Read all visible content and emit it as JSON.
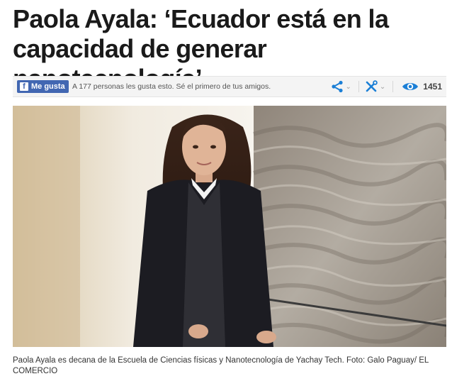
{
  "article": {
    "headline_line1": "Paola Ayala: ‘Ecuador está en la",
    "headline_line2": "capacidad de generar nanotecnología’"
  },
  "social": {
    "like_button_label": "Me gusta",
    "fb_icon_glyph": "f",
    "likes_text": "A 177 personas les gusta esto. Sé el primero de tus amigos.",
    "share_icon": "share-icon",
    "tools_icon": "wrench-screwdriver-icon",
    "views_icon": "eye-icon",
    "views_count": "1451",
    "accent_color": "#1b7fd6",
    "fb_color": "#4267b2"
  },
  "photo": {
    "description_icon": "photo-portrait",
    "caption": "Paola Ayala es decana de la Escuela de Ciencias físicas y Nanotecnología de Yachay Tech. Foto: Galo Paguay/ EL COMERCIO"
  }
}
